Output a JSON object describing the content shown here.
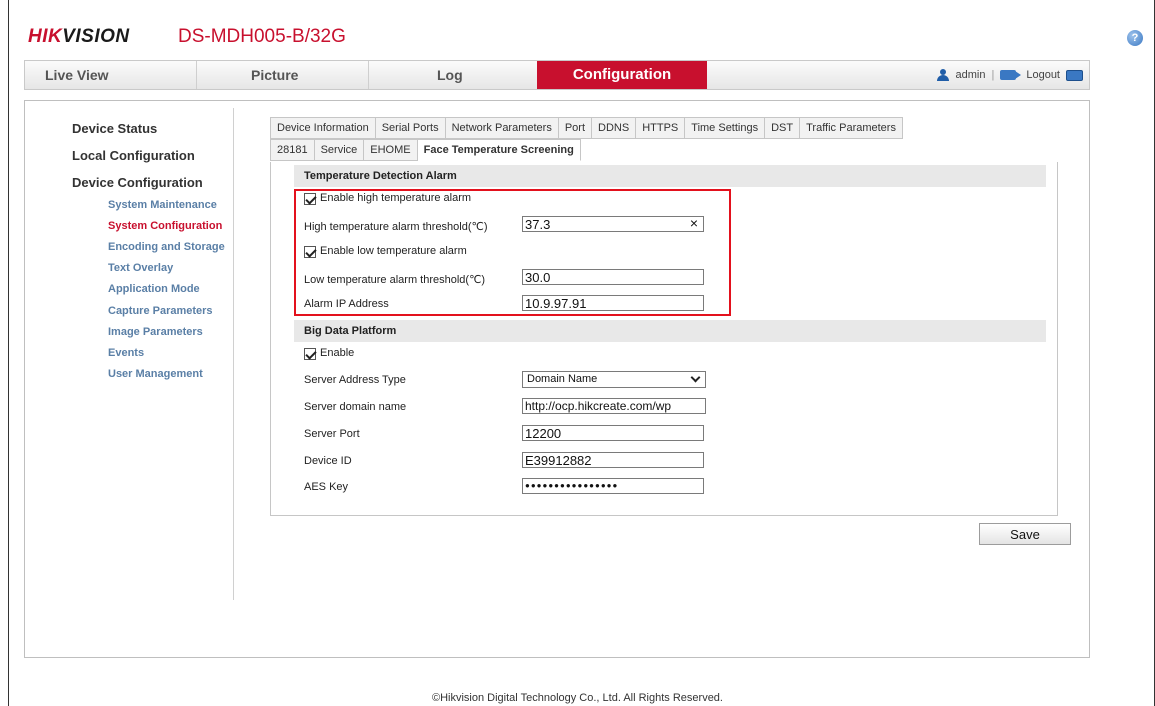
{
  "header": {
    "logo_text_red": "HIK",
    "logo_text_black": "VISION",
    "model": "DS-MDH005-B/32G",
    "help_icon": "?"
  },
  "nav": {
    "tabs": [
      "Live View",
      "Picture",
      "Log",
      "Configuration"
    ],
    "active": "Configuration",
    "user": "admin",
    "separator": "|",
    "logout": "Logout"
  },
  "sidebar": {
    "headings": [
      "Device Status",
      "Local Configuration",
      "Device Configuration"
    ],
    "items": [
      "System Maintenance",
      "System Configuration",
      "Encoding and Storage",
      "Text Overlay",
      "Application Mode",
      "Capture Parameters",
      "Image Parameters",
      "Events",
      "User Management"
    ],
    "active_item": "System Configuration"
  },
  "tabs_row1": [
    "Device Information",
    "Serial Ports",
    "Network Parameters",
    "Port",
    "DDNS",
    "HTTPS",
    "Time Settings",
    "DST",
    "Traffic Parameters"
  ],
  "tabs_row2": [
    "28181",
    "Service",
    "EHOME",
    "Face Temperature Screening"
  ],
  "active_tab": "Face Temperature Screening",
  "temp_section": {
    "title": "Temperature Detection Alarm",
    "enable_high_label": "Enable high temperature alarm",
    "enable_high_checked": true,
    "high_threshold_label": "High temperature alarm threshold(℃)",
    "high_threshold_value": "37.3",
    "enable_low_label": "Enable low temperature alarm",
    "enable_low_checked": true,
    "low_threshold_label": "Low temperature alarm threshold(℃)",
    "low_threshold_value": "30.0",
    "alarm_ip_label": "Alarm IP Address",
    "alarm_ip_value": "10.9.97.91"
  },
  "big_data": {
    "title": "Big Data Platform",
    "enable_label": "Enable",
    "enable_checked": true,
    "server_address_type_label": "Server Address Type",
    "server_address_type_value": "Domain Name",
    "server_domain_label": "Server domain name",
    "server_domain_value": "http://ocp.hikcreate.com/wp",
    "server_port_label": "Server Port",
    "server_port_value": "12200",
    "device_id_label": "Device ID",
    "device_id_value": "E39912882",
    "aes_key_label": "AES Key",
    "aes_key_value": "●●●●●●●●●●●●●●●●"
  },
  "save_label": "Save",
  "footer": "©Hikvision Digital Technology Co., Ltd. All Rights Reserved.",
  "colors": {
    "brand_red": "#c8102e",
    "link_blue": "#5a7fa6",
    "highlight_red": "#e3111d"
  }
}
